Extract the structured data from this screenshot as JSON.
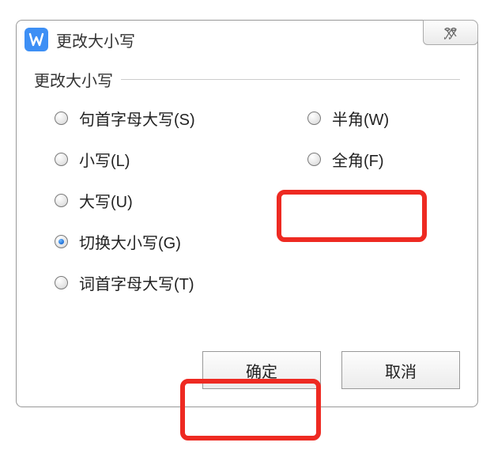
{
  "dialog": {
    "title": "更改大小写",
    "close_glyph": "✕"
  },
  "fieldset": {
    "legend": "更改大小写"
  },
  "options": {
    "sentence_case": "句首字母大写(S)",
    "lowercase": "小写(L)",
    "uppercase": "大写(U)",
    "toggle_case": "切换大小写(G)",
    "title_case": "词首字母大写(T)",
    "half_width": "半角(W)",
    "full_width": "全角(F)",
    "selected": "toggle_case"
  },
  "buttons": {
    "ok": "确定",
    "cancel": "取消"
  },
  "highlights": [
    "full_width",
    "ok"
  ]
}
